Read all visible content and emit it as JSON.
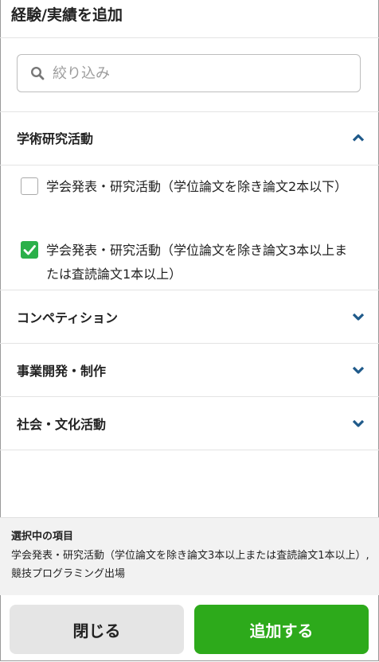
{
  "header": {
    "title": "経験/実績を追加"
  },
  "search": {
    "placeholder": "絞り込み"
  },
  "sections": [
    {
      "label": "学術研究活動",
      "expanded": true,
      "items": [
        {
          "label": "学会発表・研究活動（学位論文を除き論文2本以下）",
          "checked": false
        },
        {
          "label": "学会発表・研究活動（学位論文を除き論文3本以上または査読論文1本以上）",
          "checked": true
        }
      ]
    },
    {
      "label": "コンペティション",
      "expanded": false
    },
    {
      "label": "事業開発・制作",
      "expanded": false
    },
    {
      "label": "社会・文化活動",
      "expanded": false
    }
  ],
  "selected": {
    "title": "選択中の項目",
    "text": "学会発表・研究活動（学位論文を除き論文3本以上または査読論文1本以上）, 競技プログラミング出場"
  },
  "buttons": {
    "close_label": "閉じる",
    "add_label": "追加する"
  },
  "colors": {
    "accent_green": "#2daa1b",
    "chevron": "#1f5a8a"
  }
}
